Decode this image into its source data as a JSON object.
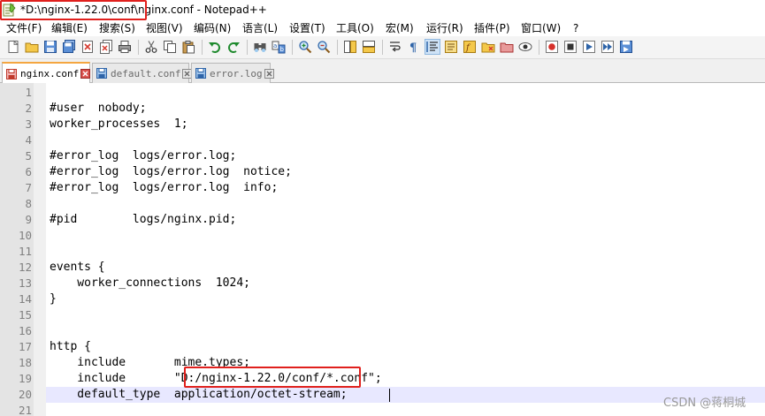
{
  "window": {
    "title": "*D:\\nginx-1.22.0\\conf\\nginx.conf - Notepad++"
  },
  "menu": [
    "文件(F)",
    "编辑(E)",
    "搜索(S)",
    "视图(V)",
    "编码(N)",
    "语言(L)",
    "设置(T)",
    "工具(O)",
    "宏(M)",
    "运行(R)",
    "插件(P)",
    "窗口(W)",
    "?"
  ],
  "toolbar": {
    "icons": [
      "new-file-icon",
      "open-file-icon",
      "save-icon",
      "save-all-icon",
      "close-icon",
      "close-all-icon",
      "print-icon",
      "cut-icon",
      "copy-icon",
      "paste-icon",
      "undo-icon",
      "redo-icon",
      "find-icon",
      "replace-icon",
      "zoom-in-icon",
      "zoom-out-icon",
      "sync-vertical-icon",
      "sync-horizontal-icon",
      "word-wrap-icon",
      "show-all-chars-icon",
      "indent-guide-icon",
      "doc-map-icon",
      "function-list-icon",
      "folder-workspace-icon",
      "document-list-icon",
      "monitor-icon",
      "record-macro-icon",
      "stop-macro-icon",
      "play-macro-icon",
      "run-macro-multiple-icon",
      "save-macro-icon"
    ],
    "active_icon": "indent-guide-icon"
  },
  "tabs": [
    {
      "label": "nginx.conf",
      "active": true,
      "modified": true
    },
    {
      "label": "default.conf",
      "active": false,
      "modified": false
    },
    {
      "label": "error.log",
      "active": false,
      "modified": false
    }
  ],
  "editor": {
    "current_line": 20,
    "lines": [
      {
        "num": "1",
        "text": ""
      },
      {
        "num": "2",
        "text": "#user  nobody;"
      },
      {
        "num": "3",
        "text": "worker_processes  1;"
      },
      {
        "num": "4",
        "text": ""
      },
      {
        "num": "5",
        "text": "#error_log  logs/error.log;"
      },
      {
        "num": "6",
        "text": "#error_log  logs/error.log  notice;"
      },
      {
        "num": "7",
        "text": "#error_log  logs/error.log  info;"
      },
      {
        "num": "8",
        "text": ""
      },
      {
        "num": "9",
        "text": "#pid        logs/nginx.pid;"
      },
      {
        "num": "10",
        "text": ""
      },
      {
        "num": "11",
        "text": ""
      },
      {
        "num": "12",
        "text": "events {"
      },
      {
        "num": "13",
        "text": "    worker_connections  1024;"
      },
      {
        "num": "14",
        "text": "}"
      },
      {
        "num": "15",
        "text": ""
      },
      {
        "num": "16",
        "text": ""
      },
      {
        "num": "17",
        "text": "http {"
      },
      {
        "num": "18",
        "text": "    include       mime.types;"
      },
      {
        "num": "19",
        "text": "    include       \"D:/nginx-1.22.0/conf/*.conf\";"
      },
      {
        "num": "20",
        "text": "    default_type  application/octet-stream;"
      },
      {
        "num": "21",
        "text": ""
      }
    ]
  },
  "watermark": "CSDN @蒋桐城",
  "colors": {
    "highlight_box": "#e0201d",
    "tab_accent": "#f4a640",
    "current_line": "#e8e8ff"
  }
}
